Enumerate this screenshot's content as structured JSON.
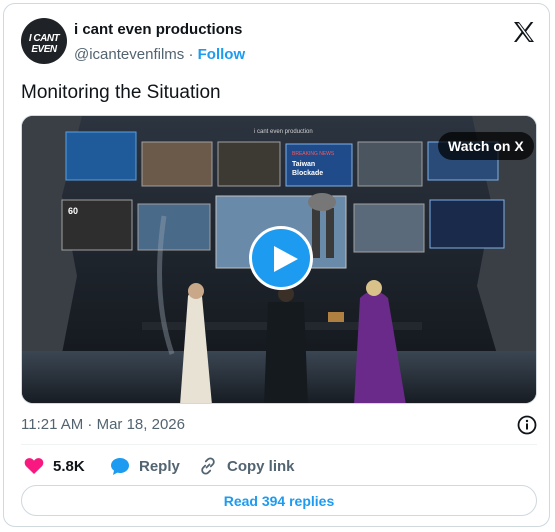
{
  "author": {
    "avatar_text": "I CANT EVEN",
    "display_name": "i cant even productions",
    "handle": "@icantevenfilms",
    "separator": "·",
    "follow_label": "Follow"
  },
  "tweet": {
    "text": "Monitoring the Situation",
    "timestamp": "11:21 AM · Mar 18, 2026"
  },
  "media": {
    "watch_label": "Watch on X",
    "overlay_caption": "i cant even production",
    "screen_labels": {
      "breaking": "BREAKING NEWS",
      "taiwan": "Taiwan\nBlockade",
      "sixty": "60\nMINUTES"
    }
  },
  "actions": {
    "likes": "5.8K",
    "reply_label": "Reply",
    "copy_label": "Copy link"
  },
  "footer": {
    "read_replies_label": "Read 394 replies"
  },
  "colors": {
    "accent": "#1d9bf0",
    "heart": "#f91880",
    "text": "#0f1419",
    "secondary": "#536471"
  },
  "icons": [
    "x-logo-icon",
    "play-icon",
    "info-icon",
    "heart-icon",
    "reply-bubble-icon",
    "link-icon"
  ]
}
